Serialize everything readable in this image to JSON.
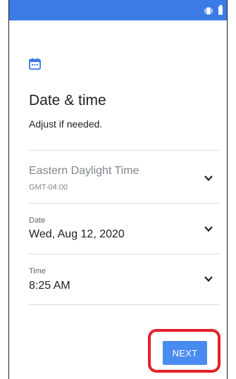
{
  "header": {
    "title": "Date & time",
    "subtitle": "Adjust if needed."
  },
  "timezone": {
    "value": "Eastern Daylight Time",
    "offset": "GMT-04:00"
  },
  "date": {
    "label": "Date",
    "value": "Wed, Aug 12, 2020"
  },
  "time": {
    "label": "Time",
    "value": "8:25 AM"
  },
  "actions": {
    "next_label": "NEXT"
  },
  "colors": {
    "status_bar": "#3b7be6",
    "accent": "#4a8bf0",
    "highlight": "#e5202a"
  },
  "icons": {
    "status": [
      "vibrate-icon",
      "battery-icon"
    ],
    "header": "calendar-icon",
    "rows": "chevron-down-icon"
  }
}
